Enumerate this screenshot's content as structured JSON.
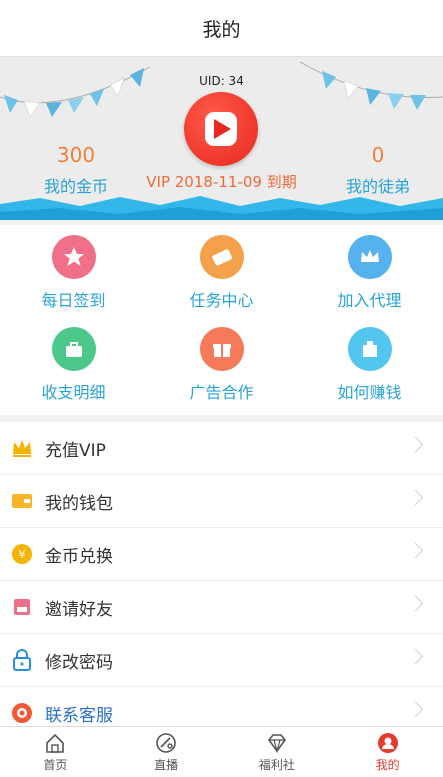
{
  "title": "我的",
  "profile": {
    "uid": "UID: 34",
    "coins_value": "300",
    "coins_label": "我的金币",
    "vip_text": "VIP 2018-11-09 到期",
    "apprentices_value": "0",
    "apprentices_label": "我的徒弟"
  },
  "shortcuts": [
    {
      "label": "每日签到",
      "icon": "star-icon",
      "color": "#f0708a"
    },
    {
      "label": "任务中心",
      "icon": "ticket-icon",
      "color": "#f5a04a"
    },
    {
      "label": "加入代理",
      "icon": "crown-icon",
      "color": "#56b2ee"
    },
    {
      "label": "收支明细",
      "icon": "bag-icon",
      "color": "#4cc98a"
    },
    {
      "label": "广告合作",
      "icon": "gift-icon",
      "color": "#f47a5a"
    },
    {
      "label": "如何赚钱",
      "icon": "building-icon",
      "color": "#52c6ee"
    }
  ],
  "menu": [
    {
      "label": "充值VIP",
      "icon": "crown-icon"
    },
    {
      "label": "我的钱包",
      "icon": "wallet-icon"
    },
    {
      "label": "金币兑换",
      "icon": "coin-icon"
    },
    {
      "label": "邀请好友",
      "icon": "invite-icon"
    },
    {
      "label": "修改密码",
      "icon": "lock-icon"
    },
    {
      "label": "联系客服",
      "icon": "service-icon"
    }
  ],
  "tabs": [
    {
      "label": "首页",
      "icon": "home-icon"
    },
    {
      "label": "直播",
      "icon": "live-icon"
    },
    {
      "label": "福利社",
      "icon": "diamond-icon"
    },
    {
      "label": "我的",
      "icon": "profile-icon",
      "active": true
    }
  ],
  "colors": {
    "accent": "#2aa3d8",
    "orange": "#f0803a",
    "active_tab": "#e53b2f"
  }
}
